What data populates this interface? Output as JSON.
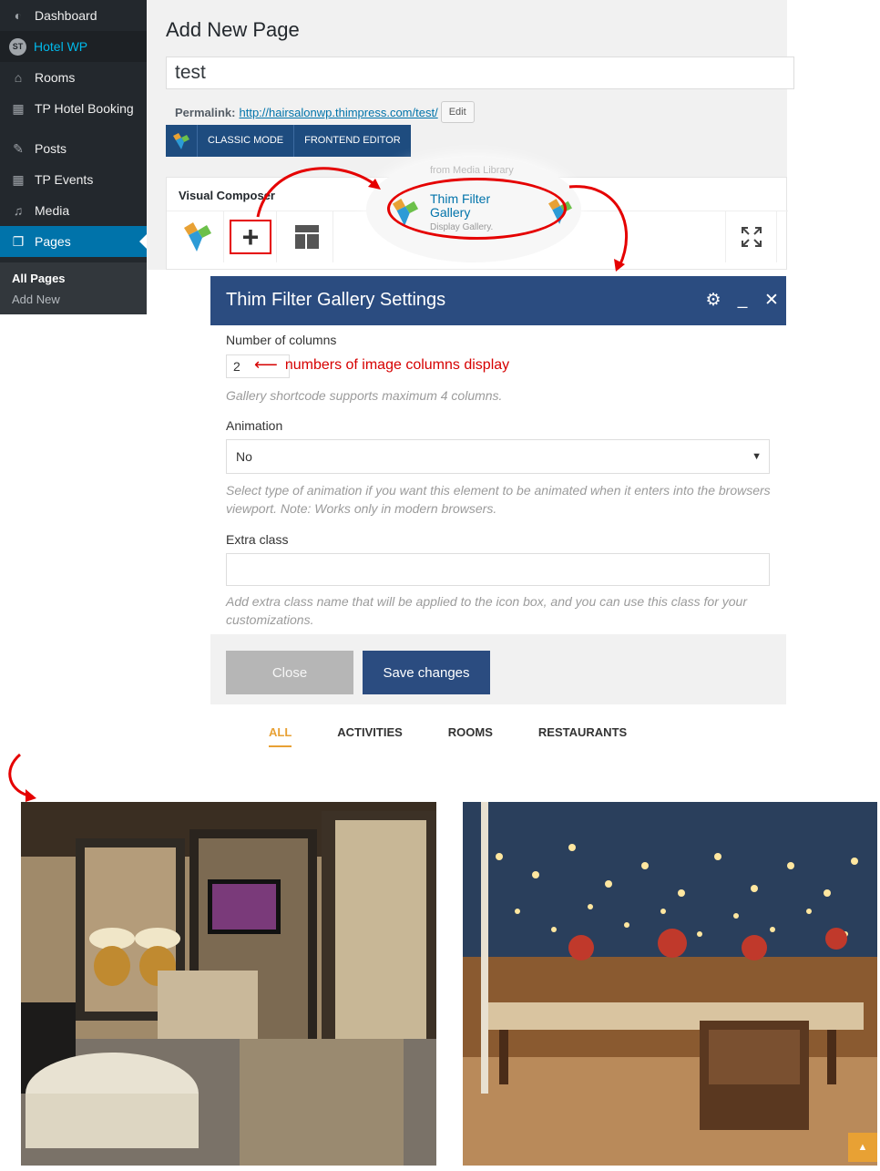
{
  "sidebar": {
    "items": [
      {
        "label": "Dashboard",
        "icon": "dashboard-icon"
      },
      {
        "label": "Hotel WP",
        "icon": "thimpress-logo-icon"
      },
      {
        "label": "Rooms",
        "icon": "home-icon"
      },
      {
        "label": "TP Hotel Booking",
        "icon": "calendar-icon"
      },
      {
        "label": "Posts",
        "icon": "pin-icon"
      },
      {
        "label": "TP Events",
        "icon": "calendar-icon"
      },
      {
        "label": "Media",
        "icon": "media-icon"
      },
      {
        "label": "Pages",
        "icon": "pages-icon"
      }
    ],
    "hotel_logo_text": "ST",
    "submenu": [
      "All Pages",
      "Add New"
    ]
  },
  "editor": {
    "heading": "Add New Page",
    "title_value": "test",
    "permalink_label": "Permalink:",
    "permalink_url": "http://hairsalonwp.thimpress.com/test/",
    "edit_button": "Edit",
    "classic_mode": "CLASSIC MODE",
    "frontend_editor": "FRONTEND EDITOR",
    "vc_title": "Visual Composer"
  },
  "element_popup": {
    "faded_text": "from Media Library",
    "name": "Thim Filter Gallery",
    "description": "Display Gallery."
  },
  "settings_modal": {
    "title": "Thim Filter Gallery Settings",
    "columns_label": "Number of columns",
    "columns_value": "2",
    "columns_annotation": "numbers of image columns display",
    "columns_hint": "Gallery shortcode supports maximum 4 columns.",
    "animation_label": "Animation",
    "animation_value": "No",
    "animation_hint": "Select type of animation if you want this element to be animated when it enters into the browsers viewport. Note: Works only in modern browsers.",
    "extra_class_label": "Extra class",
    "extra_class_value": "",
    "extra_class_hint": "Add extra class name that will be applied to the icon box, and you can use this class for your customizations.",
    "close_button": "Close",
    "save_button": "Save changes"
  },
  "gallery": {
    "filters": [
      "ALL",
      "ACTIVITIES",
      "ROOMS",
      "RESTAURANTS"
    ],
    "active_filter": "ALL"
  },
  "colors": {
    "admin_bar": "#23282d",
    "wp_blue": "#0073aa",
    "modal_blue": "#2b4c80",
    "annotation_red": "#e50000",
    "accent_orange": "#e8a134"
  }
}
